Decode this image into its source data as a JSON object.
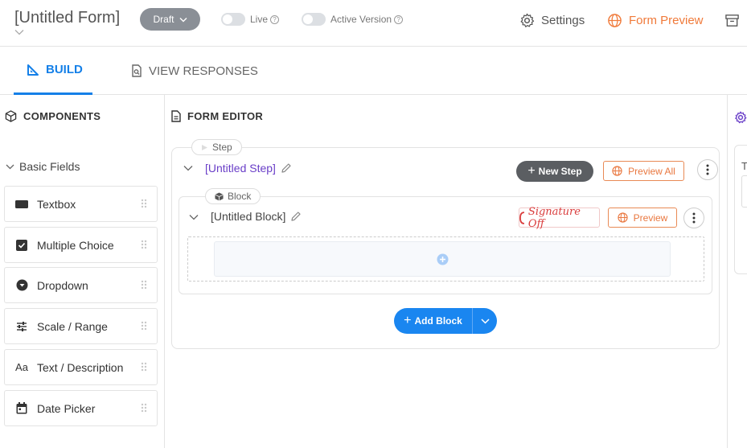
{
  "header": {
    "form_title": "[Untitled Form]",
    "status_dropdown": "Draft",
    "live_label": "Live",
    "active_version_label": "Active Version",
    "settings_label": "Settings",
    "form_preview_label": "Form Preview"
  },
  "tabs": {
    "build": "BUILD",
    "view_responses": "VIEW RESPONSES"
  },
  "components_panel": {
    "title": "COMPONENTS",
    "group": "Basic Fields",
    "items": [
      {
        "label": "Textbox",
        "icon": "textbox-icon"
      },
      {
        "label": "Multiple Choice",
        "icon": "checkbox-icon"
      },
      {
        "label": "Dropdown",
        "icon": "dropdown-circle-icon"
      },
      {
        "label": "Scale / Range",
        "icon": "sliders-icon"
      },
      {
        "label": "Text / Description",
        "icon": "text-aa-icon"
      },
      {
        "label": "Date Picker",
        "icon": "calendar-icon"
      }
    ]
  },
  "editor": {
    "title": "FORM EDITOR",
    "step_tag": "Step",
    "step_title": "[Untitled Step]",
    "new_step": "New Step",
    "preview_all": "Preview All",
    "block_tag": "Block",
    "block_title": "[Untitled Block]",
    "signature_off": "Signature Off",
    "preview": "Preview",
    "add_block": "Add Block"
  },
  "right_panel": {
    "letter": "T"
  },
  "colors": {
    "accent_blue": "#1580e8",
    "accent_orange": "#f07a3a",
    "step_title_purple": "#6a3fc8",
    "signature_red": "#d93b3b"
  }
}
